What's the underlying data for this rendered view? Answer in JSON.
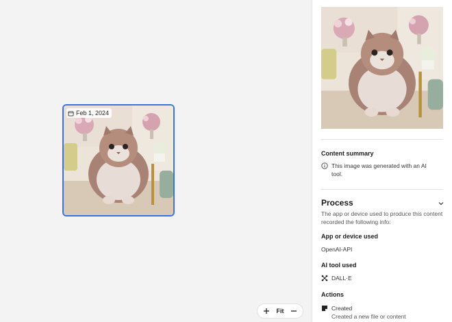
{
  "canvas": {
    "thumbnail": {
      "date": "Feb 1, 2024"
    },
    "zoom": {
      "plus": "+",
      "fit": "Fit",
      "minus": "−"
    }
  },
  "panel": {
    "content_summary": {
      "title": "Content summary",
      "text_line1": "This image was generated with an AI",
      "text_line2": "tool."
    },
    "process": {
      "title": "Process",
      "desc_line1": "The app or device used to produce this content",
      "desc_line2": "recorded the following info:",
      "app_label": "App or device used",
      "app_value": "OpenAI-API",
      "ai_label": "AI tool used",
      "ai_value": "DALL·E",
      "actions_label": "Actions",
      "action_title": "Created",
      "action_desc": "Created a new file or content"
    }
  },
  "colors": {
    "selection": "#3a73e0",
    "panel_bg": "#ffffff",
    "canvas_bg": "#f3f3f3"
  },
  "icons": [
    "calendar-icon",
    "info-icon",
    "chevron-down-icon",
    "dalle-icon",
    "created-icon",
    "plus-icon",
    "minus-icon"
  ]
}
